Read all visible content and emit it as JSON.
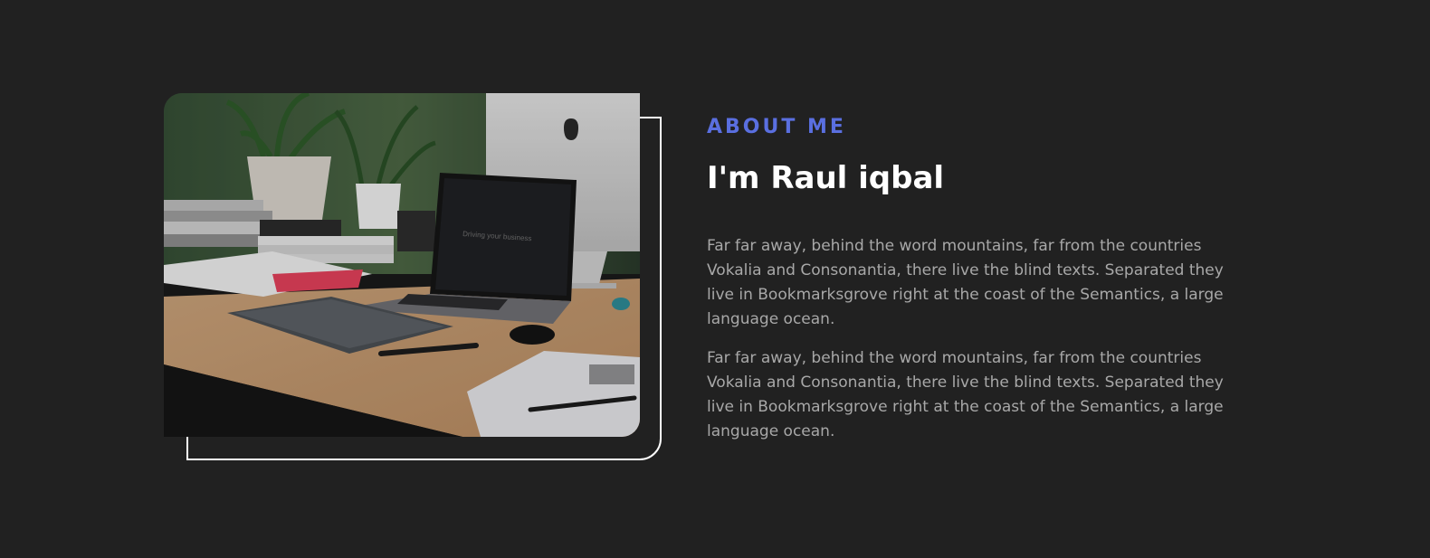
{
  "about": {
    "eyebrow": "ABOUT ME",
    "title": "I'm Raul iqbal",
    "paragraphs": [
      "Far far away, behind the word mountains, far from the countries Vokalia and Consonantia, there live the blind texts. Separated they live in Bookmarksgrove right at the coast of the Semantics, a large language ocean.",
      "Far far away, behind the word mountains, far from the countries Vokalia and Consonantia, there live the blind texts. Separated they live in Bookmarksgrove right at the coast of the Semantics, a large language ocean."
    ],
    "image": {
      "subject": "workspace-photo",
      "screen_text": "Driving your business"
    }
  },
  "colors": {
    "background": "#212121",
    "accent": "#5a6fe0",
    "heading": "#ffffff",
    "body_text": "#a8a8a8",
    "frame": "#ffffff"
  }
}
